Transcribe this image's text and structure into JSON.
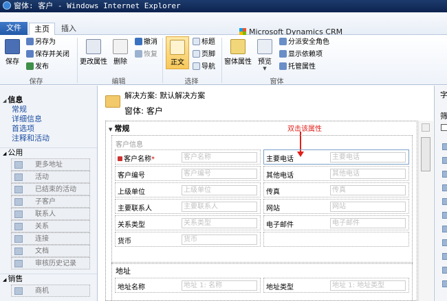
{
  "window": {
    "title": "窗体: 客户 - Windows Internet Explorer"
  },
  "ribbon_tabs": {
    "file": "文件",
    "home": "主页",
    "insert": "插入"
  },
  "brand": {
    "name": "Microsoft Dynamics CRM"
  },
  "ribbon": {
    "save": "保存",
    "save_as": "另存为",
    "save_close": "保存并关闭",
    "publish": "发布",
    "group_save": "保存",
    "change_props": "更改属性",
    "delete": "删除",
    "undo": "撤消",
    "redo": "恢复",
    "group_edit": "编辑",
    "body": "正文",
    "header": "标题",
    "footer": "页脚",
    "navigation": "导航",
    "group_select": "选择",
    "form_props": "窗体属性",
    "preview": "预览",
    "managed_props_field_security": "分派安全角色",
    "show_dependencies": "显示依赖项",
    "managed_props": "托管属性",
    "group_form": "窗体"
  },
  "leftnav": {
    "info_header": "信息",
    "info_links": [
      "常规",
      "详细信息",
      "首选项",
      "注释和活动"
    ],
    "common_header": "公用",
    "common_items": [
      "更多地址",
      "活动",
      "已结束的活动",
      "子客户",
      "联系人",
      "关系",
      "连接",
      "文档",
      "审核历史记录"
    ],
    "sales_header": "销售",
    "sales_items": [
      "商机"
    ]
  },
  "form_header": {
    "solution": "解决方案: 默认解决方案",
    "entity": "窗体: 客户"
  },
  "canvas": {
    "tab_title": "常规",
    "annotation": "双击该属性",
    "section1_title": "客户信息",
    "fields_left": [
      {
        "label": "客户名称",
        "placeholder": "客户名称"
      },
      {
        "label": "客户编号",
        "placeholder": "客户编号"
      },
      {
        "label": "上级单位",
        "placeholder": "上级单位"
      },
      {
        "label": "主要联系人",
        "placeholder": "主要联系人"
      },
      {
        "label": "关系类型",
        "placeholder": "关系类型"
      },
      {
        "label": "货币",
        "placeholder": "货币"
      }
    ],
    "fields_right": [
      {
        "label": "主要电话",
        "placeholder": "主要电话"
      },
      {
        "label": "其他电话",
        "placeholder": "其他电话"
      },
      {
        "label": "传真",
        "placeholder": "传真"
      },
      {
        "label": "网站",
        "placeholder": "网站"
      },
      {
        "label": "电子邮件",
        "placeholder": "电子邮件"
      }
    ],
    "required_mark": "*",
    "section2_title": "地址",
    "address_fields": [
      {
        "label": "地址名称",
        "placeholder": "地址 1: 名称"
      },
      {
        "label": "地址类型",
        "placeholder": "地址 1: 地址类型"
      }
    ]
  },
  "rightpane": {
    "t1": "字",
    "t2": "筛"
  }
}
